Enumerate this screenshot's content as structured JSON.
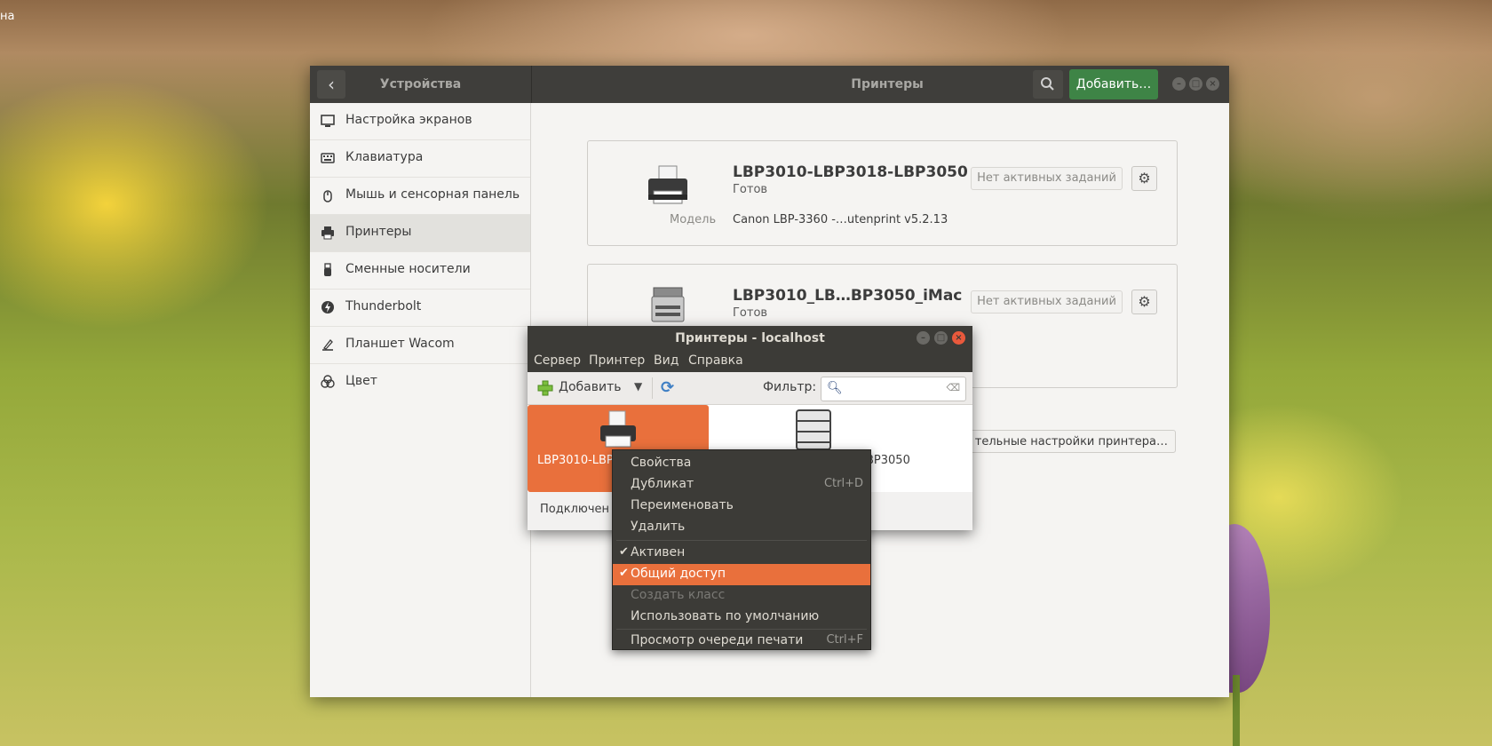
{
  "desktop": {
    "label": "на"
  },
  "settings": {
    "back_icon": "chevron-left-icon",
    "left_title": "Устройства",
    "title": "Принтеры",
    "search_icon": "search-icon",
    "add_label": "Добавить…",
    "sidebar": [
      {
        "label": "Настройка экранов",
        "icon": "display-icon"
      },
      {
        "label": "Клавиатура",
        "icon": "keyboard-icon"
      },
      {
        "label": "Мышь и сенсорная панель",
        "icon": "mouse-icon"
      },
      {
        "label": "Принтеры",
        "icon": "printer-icon"
      },
      {
        "label": "Сменные носители",
        "icon": "usb-icon"
      },
      {
        "label": "Thunderbolt",
        "icon": "thunderbolt-icon"
      },
      {
        "label": "Планшет Wacom",
        "icon": "tablet-icon"
      },
      {
        "label": "Цвет",
        "icon": "color-icon"
      }
    ],
    "active_index": 3,
    "printers": [
      {
        "name": "LBP3010-LBP3018-LBP3050",
        "status": "Готов",
        "model_key": "Модель",
        "model_value": "Canon LBP-3360 -…utenprint v5.2.13",
        "jobs": "Нет активных заданий"
      },
      {
        "name": "LBP3010_LB…BP3050_iMac",
        "status": "Готов",
        "jobs": "Нет активных заданий"
      }
    ],
    "more_settings": "тельные настройки принтера…"
  },
  "cups": {
    "title": "Принтеры - localhost",
    "menu": [
      "Сервер",
      "Принтер",
      "Вид",
      "Справка"
    ],
    "toolbar": {
      "add": "Добавить",
      "filter_label": "Фильтр:",
      "filter_value": ""
    },
    "printers": [
      {
        "label": "LBP3010-LBP",
        "selected": true
      },
      {
        "label": "BP3050",
        "selected": false
      }
    ],
    "status": "Подключен"
  },
  "context_menu": {
    "items": [
      {
        "label": "Свойства"
      },
      {
        "label": "Дубликат",
        "accel": "Ctrl+D"
      },
      {
        "label": "Переименовать"
      },
      {
        "label": "Удалить"
      },
      {
        "label": "Активен",
        "checked": true
      },
      {
        "label": "Общий доступ",
        "checked": true,
        "highlighted": true
      },
      {
        "label": "Создать класс",
        "disabled": true
      },
      {
        "label": "Использовать по умолчанию"
      },
      {
        "label": "Просмотр очереди печати",
        "accel": "Ctrl+F"
      }
    ],
    "check_glyph": "✔"
  },
  "colors": {
    "accent": "#e9703c",
    "add_button": "#3e8446",
    "headerbar": "#3f3e3b"
  }
}
